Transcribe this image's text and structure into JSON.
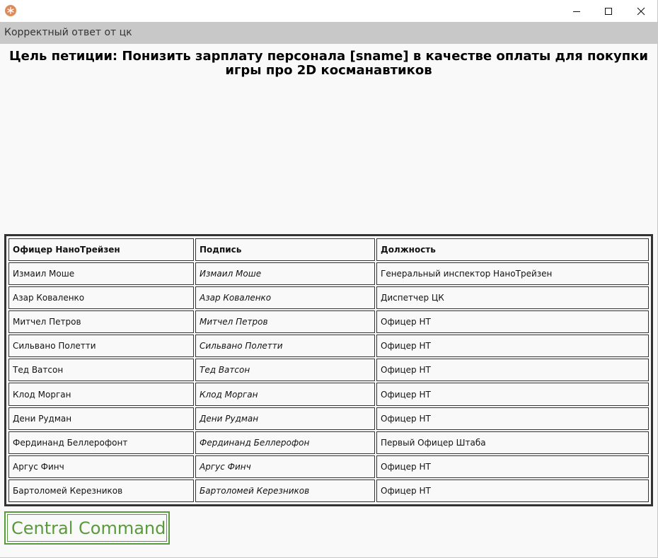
{
  "window": {
    "header_label": "Корректный ответ от цк",
    "controls": {
      "minimize": "minimize",
      "maximize": "maximize",
      "close": "close"
    }
  },
  "petition": {
    "title": "Цель петиции: Понизить зарплату персонала [sname] в качестве оплаты для покупки игры про 2D косманавтиков"
  },
  "table": {
    "headers": [
      "Офицер НаноТрейзен",
      "Подпись",
      "Должность"
    ],
    "rows": [
      [
        "Измаил Моше",
        "Измаил Моше",
        "Генеральный инспектор НаноТрейзен"
      ],
      [
        "Азар Коваленко",
        "Азар Коваленко",
        "Диспетчер ЦК"
      ],
      [
        "Митчел Петров",
        "Митчел Петров",
        "Офицер НТ"
      ],
      [
        "Сильвано Полетти",
        "Сильвано Полетти",
        "Офицер НТ"
      ],
      [
        "Тед Ватсон",
        "Тед Ватсон",
        "Офицер НТ"
      ],
      [
        "Клод Морган",
        "Клод Морган",
        "Офицер НТ"
      ],
      [
        "Дени Рудман",
        "Дени Рудман",
        "Офицер НТ"
      ],
      [
        "Фердинанд Беллерофонт",
        "Фердинанд Беллерофон",
        "Первый Офицер Штаба"
      ],
      [
        "Аргус Финч",
        "Аргус Финч",
        "Офицер НТ"
      ],
      [
        "Бартоломей Керезников",
        "Бартоломей Керезников",
        "Офицер НТ"
      ]
    ]
  },
  "stamp": {
    "label": "Central Command"
  },
  "colors": {
    "accent": "#5a9a3c",
    "header_bg": "#c8c8c8",
    "page_bg": "#f9f9f9"
  }
}
